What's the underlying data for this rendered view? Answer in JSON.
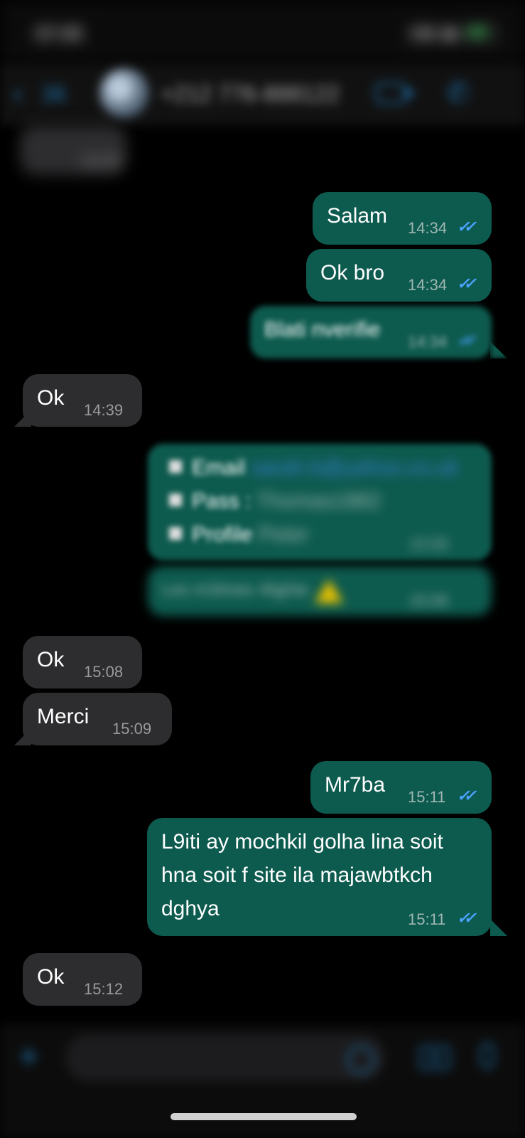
{
  "status_bar": {
    "time": "07:05"
  },
  "header": {
    "back_count": "36",
    "contact_name": "+212 776-888122"
  },
  "messages": [
    {
      "id": "m0",
      "direction": "in",
      "text": "",
      "time": "14:33",
      "blurred": true
    },
    {
      "id": "m1",
      "direction": "out",
      "text": "Salam",
      "time": "14:34",
      "ticks": "✓✓"
    },
    {
      "id": "m2",
      "direction": "out",
      "text": "Ok bro",
      "time": "14:34",
      "ticks": "✓✓"
    },
    {
      "id": "m3",
      "direction": "out",
      "text": "Blati nverifie",
      "time": "14:34",
      "ticks": "✓✓"
    },
    {
      "id": "m4",
      "direction": "in",
      "text": "Ok",
      "time": "14:39"
    },
    {
      "id": "m5",
      "direction": "out",
      "lines": [
        {
          "label": "Email",
          "value": "sarah.b@yahoo.co.uk"
        },
        {
          "label": "Pass :",
          "value": "Thomas1882"
        },
        {
          "label": "Profile",
          "value": "Peter"
        }
      ],
      "time": "15:06",
      "ticks": "✓✓"
    },
    {
      "id": "m6",
      "direction": "out",
      "text": "Les m3imes 4lighte",
      "time": "15:06",
      "ticks": "✓✓"
    },
    {
      "id": "m7",
      "direction": "in",
      "text": "Ok",
      "time": "15:08"
    },
    {
      "id": "m8",
      "direction": "in",
      "text": "Merci",
      "time": "15:09"
    },
    {
      "id": "m9",
      "direction": "out",
      "text": "Mr7ba",
      "time": "15:11",
      "ticks": "✓✓"
    },
    {
      "id": "m10",
      "direction": "out",
      "lines_text": [
        "L9iti ay mochkil golha lina soit",
        "hna soit f site ila majawbtkch",
        "dghya"
      ],
      "time": "15:11",
      "ticks": "✓✓"
    },
    {
      "id": "m11",
      "direction": "in",
      "text": "Ok",
      "time": "15:12"
    }
  ],
  "composer": {
    "placeholder": ""
  },
  "icons": {
    "back": "chevron-left-icon",
    "video": "video-call-icon",
    "phone": "phone-icon",
    "plus": "plus-icon",
    "sticker": "sticker-icon",
    "camera": "camera-icon",
    "mic": "microphone-icon"
  },
  "colors": {
    "outgoing_bubble": "#0d5a4e",
    "incoming_bubble": "#2d2d2f",
    "accent": "#1e6fa8",
    "read_ticks": "#4aa3ff"
  }
}
